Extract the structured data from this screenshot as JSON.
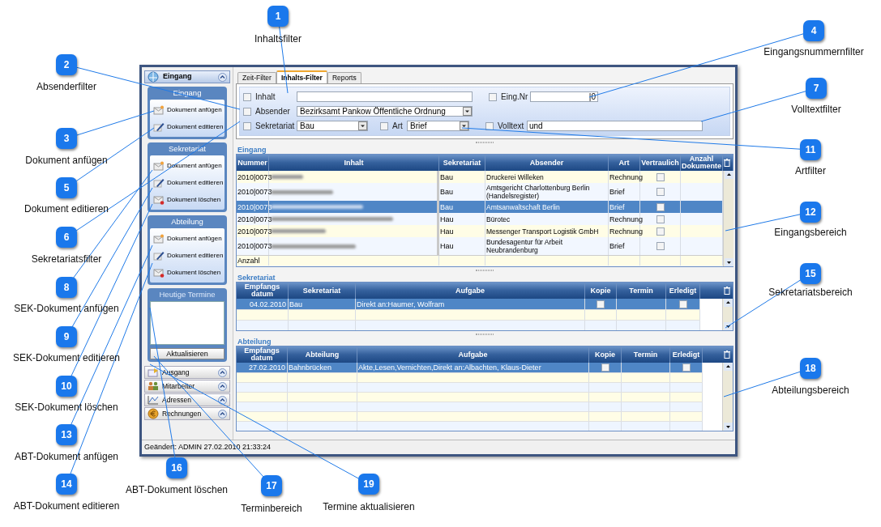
{
  "callouts": [
    {
      "number": "1",
      "label": "Inhaltsfilter"
    },
    {
      "number": "2",
      "label": "Absenderfilter"
    },
    {
      "number": "3",
      "label": "Dokument anfügen"
    },
    {
      "number": "4",
      "label": "Eingangsnummernfilter"
    },
    {
      "number": "5",
      "label": "Dokument editieren"
    },
    {
      "number": "6",
      "label": "Sekretariatsfilter"
    },
    {
      "number": "7",
      "label": "Volltextfilter"
    },
    {
      "number": "8",
      "label": "SEK-Dokument anfügen"
    },
    {
      "number": "9",
      "label": "SEK-Dokument editieren"
    },
    {
      "number": "10",
      "label": "SEK-Dokument löschen"
    },
    {
      "number": "11",
      "label": "Artfilter"
    },
    {
      "number": "12",
      "label": "Eingangsbereich"
    },
    {
      "number": "13",
      "label": "ABT-Dokument anfügen"
    },
    {
      "number": "14",
      "label": "ABT-Dokument editieren"
    },
    {
      "number": "15",
      "label": "Sekretariatsbereich"
    },
    {
      "number": "16",
      "label": "ABT-Dokument löschen"
    },
    {
      "number": "17",
      "label": "Terminbereich"
    },
    {
      "number": "18",
      "label": "Abteilungsbereich"
    },
    {
      "number": "19",
      "label": "Termine aktualisieren"
    }
  ],
  "window": {
    "sidebar": {
      "header": {
        "label": "Eingang",
        "kind": "inbox"
      },
      "groups": [
        {
          "title": "Eingang",
          "items": [
            {
              "label": "Dokument anfügen",
              "kind": "attach"
            },
            {
              "label": "Dokument editieren",
              "kind": "edit"
            }
          ]
        },
        {
          "title": "Sekretariat",
          "items": [
            {
              "label": "Dokument anfügen",
              "kind": "attach"
            },
            {
              "label": "Dokument editieren",
              "kind": "edit"
            },
            {
              "label": "Dokument löschen",
              "kind": "delete"
            }
          ]
        },
        {
          "title": "Abteilung",
          "items": [
            {
              "label": "Dokument anfügen",
              "kind": "attach"
            },
            {
              "label": "Dokument editieren",
              "kind": "edit"
            },
            {
              "label": "Dokument löschen",
              "kind": "delete"
            }
          ]
        }
      ],
      "termine": {
        "title": "Heutige Termine",
        "button": "Aktualisieren"
      },
      "sections": [
        {
          "label": "Ausgang",
          "kind": "outbox"
        },
        {
          "label": "Mitarbeiter",
          "kind": "staff"
        },
        {
          "label": "Adressen",
          "kind": "addresses"
        },
        {
          "label": "Rechnungen",
          "kind": "invoices"
        }
      ]
    },
    "tabs": [
      {
        "label": "Zeit-Filter",
        "selected": false
      },
      {
        "label": "Inhalts-Filter",
        "selected": true
      },
      {
        "label": "Reports",
        "selected": false
      }
    ],
    "filters": {
      "inhalt": {
        "label": "Inhalt",
        "checked": false,
        "kind": "text"
      },
      "eing_nr": {
        "label": "Eing.Nr",
        "checked": false,
        "kind": "text",
        "value": "|0"
      },
      "absender": {
        "label": "Absender",
        "checked": false,
        "kind": "dropdown",
        "value": "Bezirksamt Pankow Öffentliche Ordnung"
      },
      "sekretariat": {
        "label": "Sekretariat",
        "checked": false,
        "kind": "dropdown",
        "value": "Bau"
      },
      "art": {
        "label": "Art",
        "checked": false,
        "kind": "dropdown",
        "value": "Brief"
      },
      "volltext": {
        "label": "Volltext",
        "checked": false,
        "kind": "text",
        "value": "und"
      }
    },
    "eingang": {
      "title": "Eingang",
      "columns": [
        "Nummer",
        "Inhalt",
        "Sekretariat",
        "Absender",
        "Art",
        "Vertraulich",
        "Anzahl Dokumente"
      ],
      "rows": [
        {
          "nummer": "2010|0073",
          "sekretariat": "Bau",
          "absender": "Druckerei Willeken",
          "art": "Rechnung",
          "vertraulich": false,
          "selected": false
        },
        {
          "nummer": "2010|0073",
          "sekretariat": "Bau",
          "absender": "Amtsgericht Charlottenburg Berlin (Handelsregister)",
          "art": "Brief",
          "vertraulich": false,
          "selected": false
        },
        {
          "nummer": "2010|0073",
          "sekretariat": "Bau",
          "absender": "Amtsanwaltschaft Berlin",
          "art": "Brief",
          "vertraulich": false,
          "selected": true
        },
        {
          "nummer": "2010|0073",
          "sekretariat": "Hau",
          "absender": "Bürotec",
          "art": "Rechnung",
          "vertraulich": false,
          "selected": false
        },
        {
          "nummer": "2010|0073",
          "sekretariat": "Hau",
          "absender": "Messenger Transport Logistik GmbH",
          "art": "Rechnung",
          "vertraulich": false,
          "selected": false
        },
        {
          "nummer": "2010|0073",
          "sekretariat": "Hau",
          "absender": "Bundesagentur für Arbeit Neubrandenburg",
          "art": "Brief",
          "vertraulich": false,
          "selected": false
        }
      ],
      "footer": "Anzahl"
    },
    "sekretariat": {
      "title": "Sekretariat",
      "columns": [
        "Empfangs datum",
        "Sekretariat",
        "Aufgabe",
        "Kopie",
        "Termin",
        "Erledigt"
      ],
      "rows": [
        {
          "datum": "04.02.2010",
          "unit": "Bau",
          "aufgabe": "Direkt an:Haumer, Wolfram",
          "kopie": false,
          "erledigt": false,
          "selected": true
        }
      ]
    },
    "abteilung": {
      "title": "Abteilung",
      "columns": [
        "Empfangs datum",
        "Abteilung",
        "Aufgabe",
        "Kopie",
        "Termin",
        "Erledigt"
      ],
      "rows": [
        {
          "datum": "27.02.2010",
          "unit": "Bahnbrücken",
          "aufgabe": "Akte,Lesen,Vernichten,Direkt an:Albachten, Klaus-Dieter",
          "kopie": false,
          "erledigt": false,
          "selected": true
        }
      ]
    },
    "status_bar": "Geändert: ADMIN 27.02.2010 21:33:24"
  }
}
